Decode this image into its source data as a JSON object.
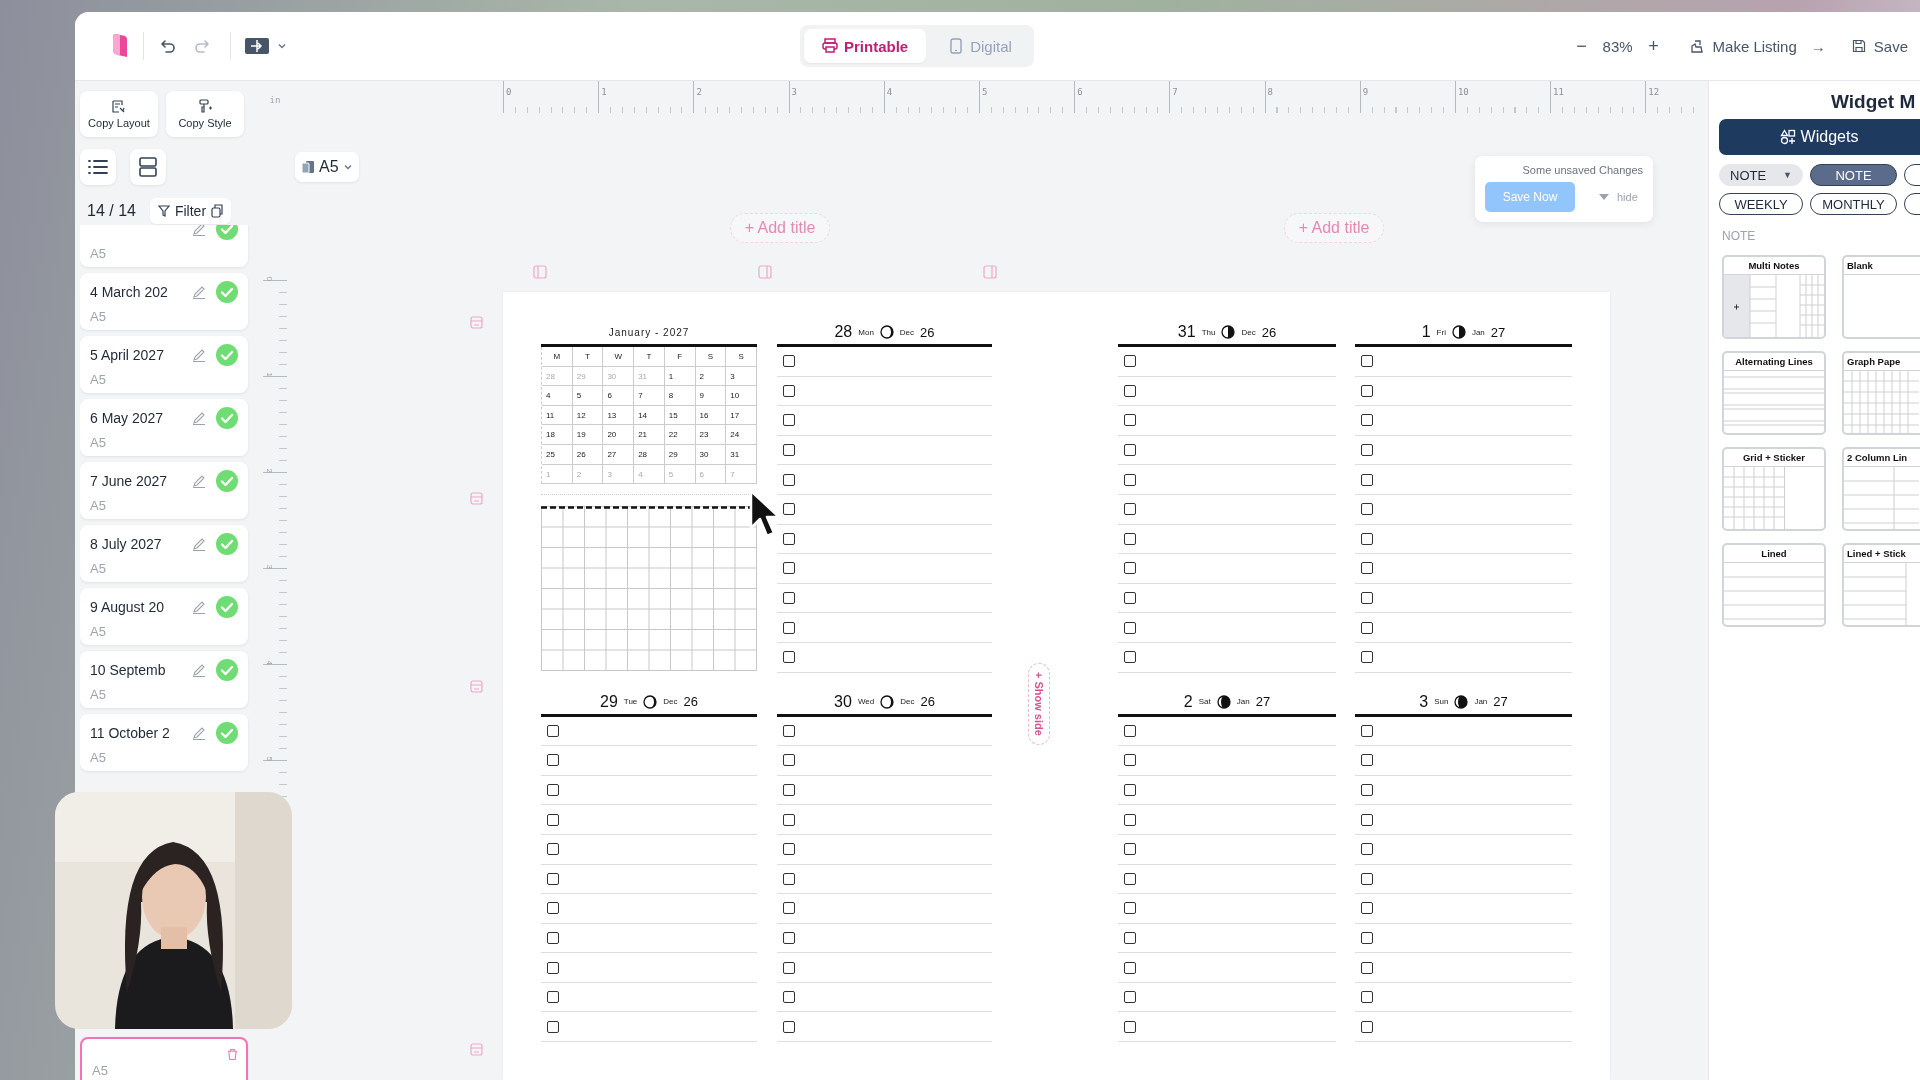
{
  "toolbar": {
    "view_tabs": [
      {
        "label": "Printable",
        "selected": true
      },
      {
        "label": "Digital",
        "selected": false
      }
    ],
    "zoom_out": "−",
    "zoom": "83%",
    "zoom_in": "+",
    "make_listing": "Make Listing",
    "make_listing_arrow": "→",
    "save": "Save"
  },
  "left_panel": {
    "actions": [
      "Copy Layout",
      "Copy Style"
    ],
    "page_count": "14 / 14",
    "filter": "Filter",
    "pages": [
      {
        "subtitle": "A5",
        "done": true,
        "selected": false
      },
      {
        "title": "4 March 202",
        "subtitle": "A5",
        "done": true,
        "selected": false
      },
      {
        "title": "5 April 2027",
        "subtitle": "A5",
        "done": true,
        "selected": false
      },
      {
        "title": "6 May 2027",
        "subtitle": "A5",
        "done": true,
        "selected": false
      },
      {
        "title": "7 June 2027",
        "subtitle": "A5",
        "done": true,
        "selected": false
      },
      {
        "title": "8 July 2027",
        "subtitle": "A5",
        "done": true,
        "selected": false
      },
      {
        "title": "9 August 20",
        "subtitle": "A5",
        "done": true,
        "selected": false
      },
      {
        "title": "10 Septemb",
        "subtitle": "A5",
        "done": true,
        "selected": false
      },
      {
        "title": "11 October 2",
        "subtitle": "A5",
        "done": true,
        "selected": false
      },
      {
        "subtitle": "A5",
        "done": false,
        "selected": true
      }
    ]
  },
  "canvas": {
    "unit": "in",
    "ruler_h": [
      "0",
      "1",
      "2",
      "3",
      "4",
      "5",
      "6",
      "7",
      "8",
      "9",
      "10",
      "11",
      "12"
    ],
    "ruler_v": [
      "0",
      "1",
      "2",
      "3",
      "4",
      "5"
    ],
    "paper_size": "A5",
    "titles": [
      "+ Add title",
      "+ Add title"
    ],
    "toast": {
      "message": "Some unsaved Changes",
      "action": "Save Now",
      "dismiss": "hide"
    },
    "spread": {
      "left": [
        {
          "kind": "month",
          "title": "January - 2027",
          "weekdays": [
            "M",
            "T",
            "W",
            "T",
            "F",
            "S",
            "S"
          ],
          "weeks": [
            [
              {
                "text": "28",
                "muted": true
              },
              {
                "text": "29",
                "muted": true
              },
              {
                "text": "30",
                "muted": true
              },
              {
                "text": "31",
                "muted": true
              },
              {
                "text": "1",
                "muted": false
              },
              {
                "text": "2",
                "muted": false
              },
              {
                "text": "3",
                "muted": false
              }
            ],
            [
              {
                "text": "4",
                "muted": false
              },
              {
                "text": "5",
                "muted": false
              },
              {
                "text": "6",
                "muted": false
              },
              {
                "text": "7",
                "muted": false
              },
              {
                "text": "8",
                "muted": false
              },
              {
                "text": "9",
                "muted": false
              },
              {
                "text": "10",
                "muted": false
              }
            ],
            [
              {
                "text": "11",
                "muted": false
              },
              {
                "text": "12",
                "muted": false
              },
              {
                "text": "13",
                "muted": false
              },
              {
                "text": "14",
                "muted": false
              },
              {
                "text": "15",
                "muted": false
              },
              {
                "text": "16",
                "muted": false
              },
              {
                "text": "17",
                "muted": false
              }
            ],
            [
              {
                "text": "18",
                "muted": false
              },
              {
                "text": "19",
                "muted": false
              },
              {
                "text": "20",
                "muted": false
              },
              {
                "text": "21",
                "muted": false
              },
              {
                "text": "22",
                "muted": false
              },
              {
                "text": "23",
                "muted": false
              },
              {
                "text": "24",
                "muted": false
              }
            ],
            [
              {
                "text": "25",
                "muted": false
              },
              {
                "text": "26",
                "muted": false
              },
              {
                "text": "27",
                "muted": false
              },
              {
                "text": "28",
                "muted": false
              },
              {
                "text": "29",
                "muted": false
              },
              {
                "text": "30",
                "muted": false
              },
              {
                "text": "31",
                "muted": false
              }
            ],
            [
              {
                "text": "1",
                "muted": true
              },
              {
                "text": "2",
                "muted": true
              },
              {
                "text": "3",
                "muted": true
              },
              {
                "text": "4",
                "muted": true
              },
              {
                "text": "5",
                "muted": true
              },
              {
                "text": "6",
                "muted": true
              },
              {
                "text": "7",
                "muted": true
              }
            ]
          ]
        },
        {
          "kind": "day",
          "day": "28",
          "weekday": "Mon",
          "moon": {
            "kind": "crescent"
          },
          "month": "Dec",
          "year": "26",
          "tasks": [
            {
              "checked": false
            },
            {
              "checked": false
            },
            {
              "checked": false
            },
            {
              "checked": false
            },
            {
              "checked": false
            },
            {
              "checked": false
            },
            {
              "checked": false
            },
            {
              "checked": false
            },
            {
              "checked": false
            },
            {
              "checked": false
            },
            {
              "checked": false
            }
          ]
        },
        {
          "kind": "day",
          "day": "29",
          "weekday": "Tue",
          "moon": {
            "kind": "crescent"
          },
          "month": "Dec",
          "year": "26",
          "tasks": [
            {
              "checked": false
            },
            {
              "checked": false
            },
            {
              "checked": false
            },
            {
              "checked": false
            },
            {
              "checked": false
            },
            {
              "checked": false
            },
            {
              "checked": false
            },
            {
              "checked": false
            },
            {
              "checked": false
            },
            {
              "checked": false
            },
            {
              "checked": false
            }
          ]
        },
        {
          "kind": "day",
          "day": "30",
          "weekday": "Wed",
          "moon": {
            "kind": "crescent"
          },
          "month": "Dec",
          "year": "26",
          "tasks": [
            {
              "checked": false
            },
            {
              "checked": false
            },
            {
              "checked": false
            },
            {
              "checked": false
            },
            {
              "checked": false
            },
            {
              "checked": false
            },
            {
              "checked": false
            },
            {
              "checked": false
            },
            {
              "checked": false
            },
            {
              "checked": false
            },
            {
              "checked": false
            }
          ]
        }
      ],
      "show_side": "+ Show side",
      "right": [
        {
          "kind": "day",
          "day": "31",
          "weekday": "Thu",
          "moon": {
            "kind": "quarter"
          },
          "month": "Dec",
          "year": "26",
          "tasks": [
            {
              "checked": false
            },
            {
              "checked": false
            },
            {
              "checked": false
            },
            {
              "checked": false
            },
            {
              "checked": false
            },
            {
              "checked": false
            },
            {
              "checked": false
            },
            {
              "checked": false
            },
            {
              "checked": false
            },
            {
              "checked": false
            },
            {
              "checked": false
            }
          ]
        },
        {
          "kind": "day",
          "day": "1",
          "weekday": "Fri",
          "moon": {
            "kind": "quarter"
          },
          "month": "Jan",
          "year": "27",
          "tasks": [
            {
              "checked": false
            },
            {
              "checked": false
            },
            {
              "checked": false
            },
            {
              "checked": false
            },
            {
              "checked": false
            },
            {
              "checked": false
            },
            {
              "checked": false
            },
            {
              "checked": false
            },
            {
              "checked": false
            },
            {
              "checked": false
            },
            {
              "checked": false
            }
          ]
        },
        {
          "kind": "day",
          "day": "2",
          "weekday": "Sat",
          "moon": {
            "kind": "gibbous"
          },
          "month": "Jan",
          "year": "27",
          "tasks": [
            {
              "checked": false
            },
            {
              "checked": false
            },
            {
              "checked": false
            },
            {
              "checked": false
            },
            {
              "checked": false
            },
            {
              "checked": false
            },
            {
              "checked": false
            },
            {
              "checked": false
            },
            {
              "checked": false
            },
            {
              "checked": false
            },
            {
              "checked": false
            }
          ]
        },
        {
          "kind": "day",
          "day": "3",
          "weekday": "Sun",
          "moon": {
            "kind": "gibbous"
          },
          "month": "Jan",
          "year": "27",
          "tasks": [
            {
              "checked": false
            },
            {
              "checked": false
            },
            {
              "checked": false
            },
            {
              "checked": false
            },
            {
              "checked": false
            },
            {
              "checked": false
            },
            {
              "checked": false
            },
            {
              "checked": false
            },
            {
              "checked": false
            },
            {
              "checked": false
            },
            {
              "checked": false
            }
          ]
        }
      ]
    }
  },
  "widget_panel": {
    "title": "Widget M",
    "tab": "Widgets",
    "filters": [
      {
        "label": "NOTE",
        "caret": "▼",
        "kind": "dropdown"
      },
      {
        "label": "NOTE",
        "kind": "chip",
        "selected": true
      },
      {
        "kind": "chip",
        "selected": false
      },
      {
        "label": "WEEKLY",
        "kind": "chip",
        "selected": false
      },
      {
        "label": "MONTHLY",
        "kind": "chip",
        "selected": false
      },
      {
        "kind": "chip",
        "selected": false
      }
    ],
    "section": "NOTE",
    "templates": [
      {
        "name": "Multi Notes",
        "kind": "multi"
      },
      {
        "name": "Blank",
        "kind": "blank"
      },
      {
        "name": "Alternating Lines",
        "kind": "alternating"
      },
      {
        "name": "Graph Pape",
        "kind": "graph"
      },
      {
        "name": "Grid + Sticker",
        "kind": "grid_sticker"
      },
      {
        "name": "2 Column Lin",
        "kind": "two_column"
      },
      {
        "name": "Lined",
        "kind": "lined"
      },
      {
        "name": "Lined + Stick",
        "kind": "lined_sticker"
      }
    ]
  }
}
